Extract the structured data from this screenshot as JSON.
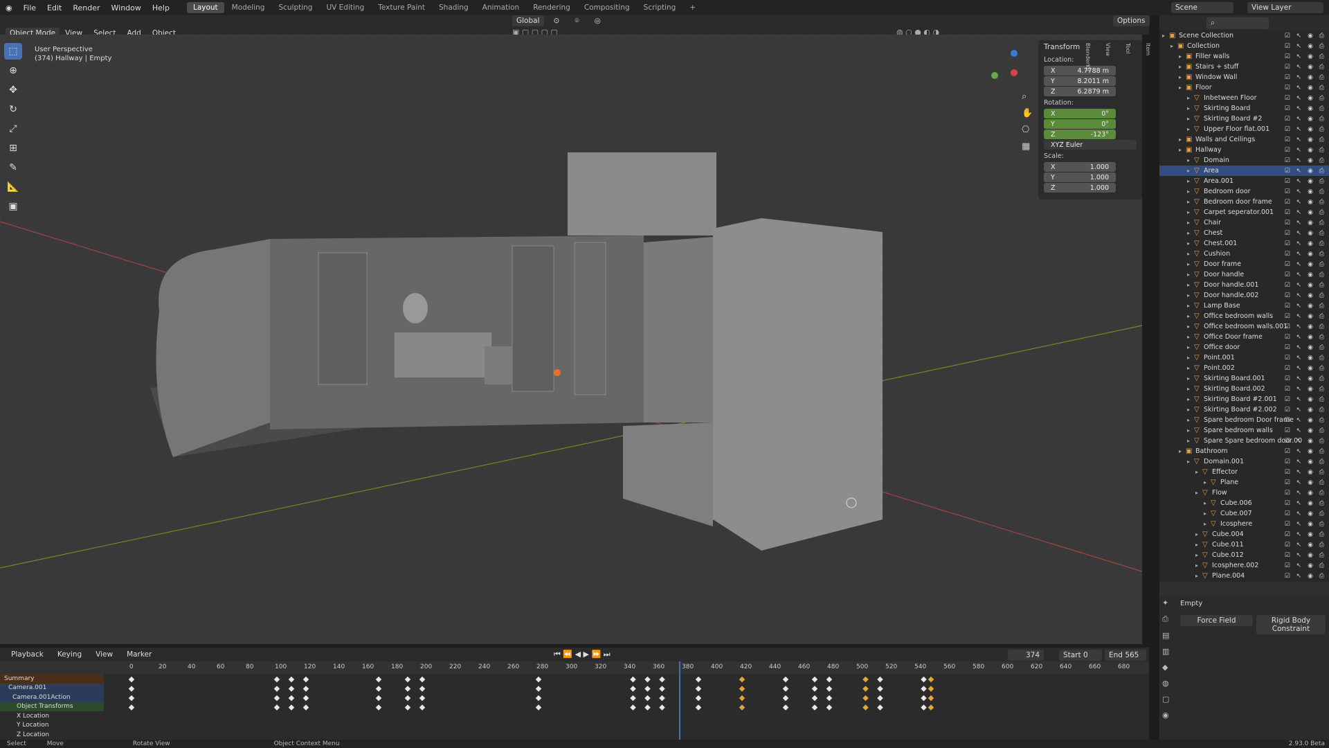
{
  "topbar": {
    "menus": [
      "File",
      "Edit",
      "Render",
      "Window",
      "Help"
    ],
    "workspaces": [
      "Layout",
      "Modeling",
      "Sculpting",
      "UV Editing",
      "Texture Paint",
      "Shading",
      "Animation",
      "Rendering",
      "Compositing",
      "Scripting"
    ],
    "active": "Layout",
    "scene": "Scene",
    "view_layer": "View Layer"
  },
  "header": {
    "mode": "Object Mode",
    "view": "View",
    "select": "Select",
    "add": "Add",
    "object": "Object",
    "orientation": "Global",
    "options": "Options"
  },
  "viewport": {
    "perspective": "User Perspective",
    "context": "(374) Hallway | Empty"
  },
  "npanel": {
    "title": "Transform",
    "location_label": "Location:",
    "loc": [
      {
        "axis": "X",
        "value": "4.7788 m"
      },
      {
        "axis": "Y",
        "value": "8.2011 m"
      },
      {
        "axis": "Z",
        "value": "6.2879 m"
      }
    ],
    "rotation_label": "Rotation:",
    "rot": [
      {
        "axis": "X",
        "value": "0°"
      },
      {
        "axis": "Y",
        "value": "0°"
      },
      {
        "axis": "Z",
        "value": "-123°"
      }
    ],
    "rot_mode": "XYZ Euler",
    "scale_label": "Scale:",
    "scale": [
      {
        "axis": "X",
        "value": "1.000"
      },
      {
        "axis": "Y",
        "value": "1.000"
      },
      {
        "axis": "Z",
        "value": "1.000"
      }
    ],
    "tabs": [
      "Item",
      "Tool",
      "View",
      "BlenderKit"
    ]
  },
  "outliner": {
    "rows": [
      {
        "d": 0,
        "name": "Scene Collection"
      },
      {
        "d": 1,
        "name": "Collection"
      },
      {
        "d": 2,
        "name": "Filler walls"
      },
      {
        "d": 2,
        "name": "Stairs + stuff"
      },
      {
        "d": 2,
        "name": "Window Wall"
      },
      {
        "d": 2,
        "name": "Floor"
      },
      {
        "d": 3,
        "name": "Inbetween Floor"
      },
      {
        "d": 3,
        "name": "Skirting Board"
      },
      {
        "d": 3,
        "name": "Skirting Board #2"
      },
      {
        "d": 3,
        "name": "Upper Floor flat.001"
      },
      {
        "d": 2,
        "name": "Walls and Ceilings"
      },
      {
        "d": 2,
        "name": "Hallway"
      },
      {
        "d": 3,
        "name": "Domain"
      },
      {
        "d": 3,
        "name": "Area"
      },
      {
        "d": 3,
        "name": "Area.001"
      },
      {
        "d": 3,
        "name": "Bedroom door"
      },
      {
        "d": 3,
        "name": "Bedroom door frame"
      },
      {
        "d": 3,
        "name": "Carpet seperator.001"
      },
      {
        "d": 3,
        "name": "Chair"
      },
      {
        "d": 3,
        "name": "Chest"
      },
      {
        "d": 3,
        "name": "Chest.001"
      },
      {
        "d": 3,
        "name": "Cushion"
      },
      {
        "d": 3,
        "name": "Door frame"
      },
      {
        "d": 3,
        "name": "Door handle"
      },
      {
        "d": 3,
        "name": "Door handle.001"
      },
      {
        "d": 3,
        "name": "Door handle.002"
      },
      {
        "d": 3,
        "name": "Lamp Base"
      },
      {
        "d": 3,
        "name": "Office bedroom walls"
      },
      {
        "d": 3,
        "name": "Office bedroom walls.001"
      },
      {
        "d": 3,
        "name": "Office Door frame"
      },
      {
        "d": 3,
        "name": "Office door"
      },
      {
        "d": 3,
        "name": "Point.001"
      },
      {
        "d": 3,
        "name": "Point.002"
      },
      {
        "d": 3,
        "name": "Skirting Board.001"
      },
      {
        "d": 3,
        "name": "Skirting Board.002"
      },
      {
        "d": 3,
        "name": "Skirting Board #2.001"
      },
      {
        "d": 3,
        "name": "Skirting Board #2.002"
      },
      {
        "d": 3,
        "name": "Spare bedroom Door frame"
      },
      {
        "d": 3,
        "name": "Spare bedroom walls"
      },
      {
        "d": 3,
        "name": "Spare Spare bedroom door.00"
      },
      {
        "d": 2,
        "name": "Bathroom"
      },
      {
        "d": 3,
        "name": "Domain.001"
      },
      {
        "d": 4,
        "name": "Effector"
      },
      {
        "d": 5,
        "name": "Plane"
      },
      {
        "d": 4,
        "name": "Flow"
      },
      {
        "d": 5,
        "name": "Cube.006"
      },
      {
        "d": 5,
        "name": "Cube.007"
      },
      {
        "d": 5,
        "name": "Icosphere"
      },
      {
        "d": 4,
        "name": "Cube.004"
      },
      {
        "d": 4,
        "name": "Cube.011"
      },
      {
        "d": 4,
        "name": "Cube.012"
      },
      {
        "d": 4,
        "name": "Icosphere.002"
      },
      {
        "d": 4,
        "name": "Plane.004"
      }
    ]
  },
  "props": {
    "object": "Empty",
    "force_field": "Force Field",
    "rigid_body_constraint": "Rigid Body Constraint"
  },
  "timeline": {
    "playback": "Playback",
    "keying": "Keying",
    "view": "View",
    "marker": "Marker",
    "current": "374",
    "start_label": "Start",
    "start": "0",
    "end_label": "End",
    "end": "565",
    "ticks": [
      "0",
      "20",
      "40",
      "60",
      "80",
      "100",
      "120",
      "140",
      "160",
      "180",
      "200",
      "220",
      "240",
      "260",
      "280",
      "300",
      "320",
      "340",
      "360",
      "380",
      "400",
      "420",
      "440",
      "460",
      "480",
      "500",
      "520",
      "540",
      "560",
      "580",
      "600",
      "620",
      "640",
      "660",
      "680"
    ],
    "channels": [
      "Summary",
      "Camera.001",
      "Camera.001Action",
      "Object Transforms",
      "X Location",
      "Y Location",
      "Z Location"
    ],
    "current_frame_fraction": 0.552
  },
  "status": {
    "select": "Select",
    "move": "Move",
    "rotate": "Rotate View",
    "context": "Object Context Menu",
    "version": "2.93.0 Beta"
  }
}
